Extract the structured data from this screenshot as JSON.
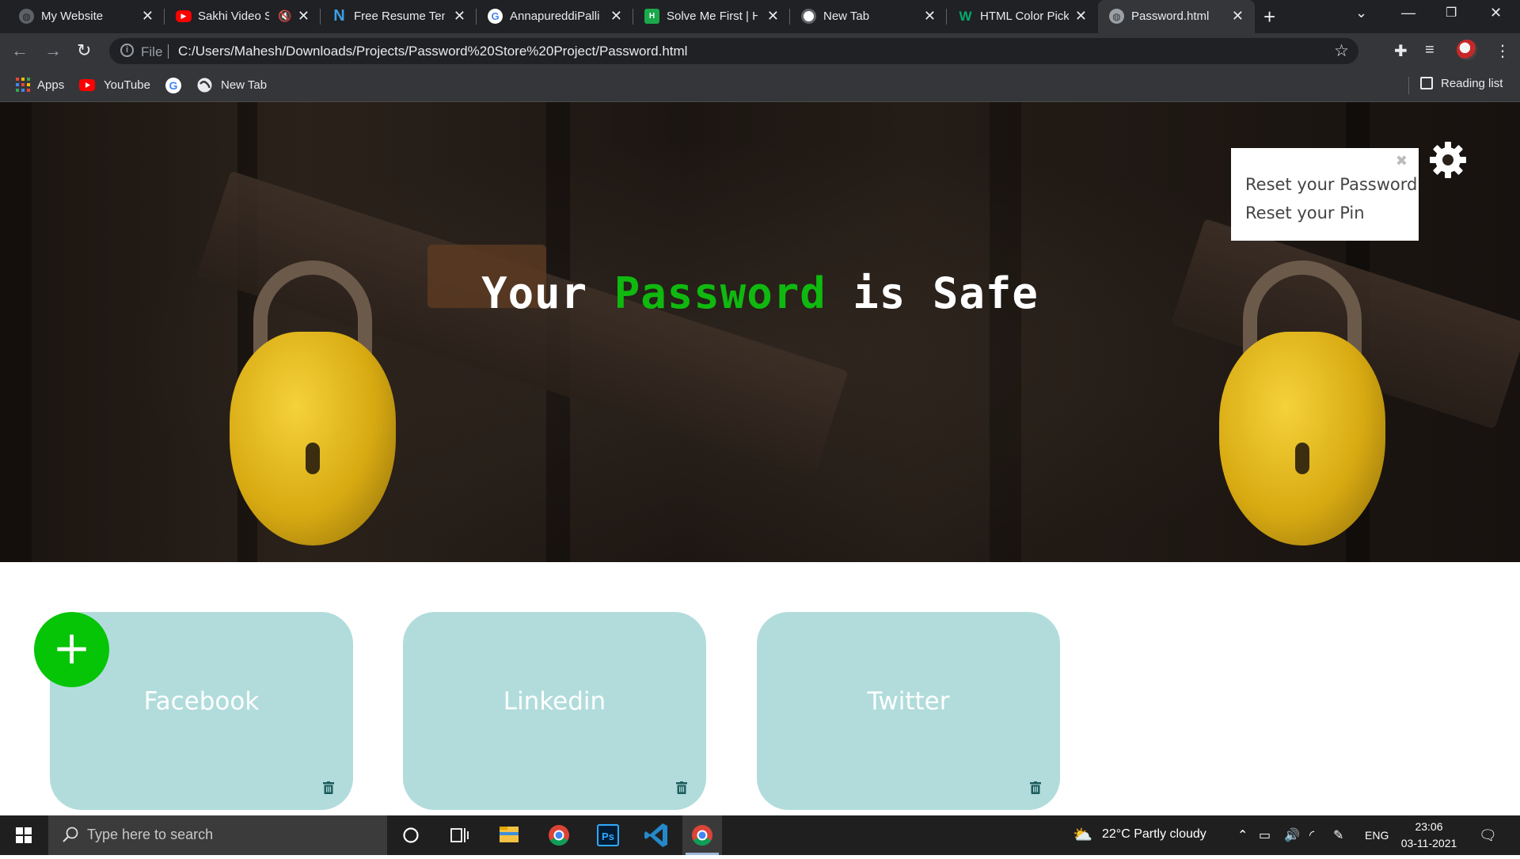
{
  "browser": {
    "tabs": [
      {
        "title": "My Website",
        "favicon": "globe-icon",
        "active": false
      },
      {
        "title": "Sakhi Video S",
        "favicon": "youtube-icon",
        "active": false,
        "muted": true
      },
      {
        "title": "Free Resume Tem",
        "favicon": "n-logo-icon",
        "active": false
      },
      {
        "title": "AnnapureddiPalli",
        "favicon": "google-icon",
        "active": false
      },
      {
        "title": "Solve Me First | H",
        "favicon": "hackerrank-icon",
        "active": false
      },
      {
        "title": "New Tab",
        "favicon": "chrome-icon",
        "active": false
      },
      {
        "title": "HTML Color Picke",
        "favicon": "w3schools-icon",
        "active": false
      },
      {
        "title": "Password.html",
        "favicon": "globe-icon",
        "active": true
      }
    ],
    "address": {
      "scheme_label": "File",
      "url": "C:/Users/Mahesh/Downloads/Projects/Password%20Store%20Project/Password.html"
    },
    "bookmarks": [
      {
        "label": "Apps",
        "icon": "apps-grid-icon"
      },
      {
        "label": "YouTube",
        "icon": "youtube-icon"
      },
      {
        "label": "",
        "icon": "google-icon"
      },
      {
        "label": "New Tab",
        "icon": "globe-icon"
      }
    ],
    "reading_list_label": "Reading list"
  },
  "page": {
    "hero_title": {
      "part1": "Your",
      "accent": "Password",
      "part2": "is Safe"
    },
    "settings_popup": {
      "items": [
        "Reset your Password",
        "Reset your Pin"
      ]
    },
    "add_button_label": "+",
    "cards": [
      {
        "label": "Facebook"
      },
      {
        "label": "Linkedin"
      },
      {
        "label": "Twitter"
      }
    ],
    "colors": {
      "accent_green": "#0fb90f",
      "card_bg": "#b2dcdc",
      "add_button": "#06c406"
    }
  },
  "taskbar": {
    "search_placeholder": "Type here to search",
    "weather": "22°C  Partly cloudy",
    "language": "ENG",
    "time": "23:06",
    "date": "03-11-2021"
  }
}
